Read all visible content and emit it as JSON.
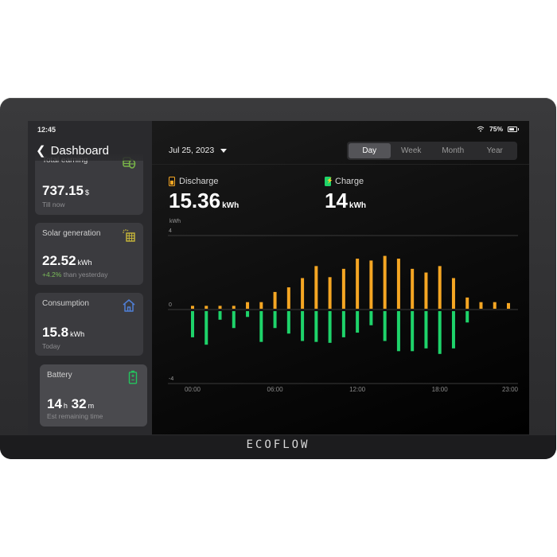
{
  "device": {
    "brand": "ECOFLOW"
  },
  "status_bar": {
    "time": "12:45",
    "battery_percent": "75%",
    "wifi_icon": "wifi-icon",
    "battery_icon": "battery-icon"
  },
  "sidebar": {
    "back_label": "Dashboard",
    "cards": [
      {
        "title": "Total earning",
        "value": "737.15",
        "unit": "$",
        "sub": "Till now",
        "icon": "coins-stack-icon",
        "icon_color": "#7ab648"
      },
      {
        "title": "Solar generation",
        "value": "22.52",
        "unit": "kWh",
        "sub_highlight": "+4.2%",
        "sub": " than yesterday",
        "icon": "solar-panel-icon",
        "icon_color": "#c9b83a"
      },
      {
        "title": "Consumption",
        "value": "15.8",
        "unit": "kWh",
        "sub": "Today",
        "icon": "house-icon",
        "icon_color": "#4f7fd6"
      },
      {
        "title": "Battery",
        "hours": "14",
        "hours_unit": "h",
        "minutes": "32",
        "minutes_unit": "m",
        "sub": "Est remaining time",
        "icon": "battery-icon",
        "icon_color": "#23c55e",
        "active": true
      }
    ]
  },
  "main": {
    "date": "Jul 25, 2023",
    "tabs": [
      {
        "label": "Day",
        "active": true
      },
      {
        "label": "Week",
        "active": false
      },
      {
        "label": "Month",
        "active": false
      },
      {
        "label": "Year",
        "active": false
      }
    ],
    "discharge": {
      "label": "Discharge",
      "value": "15.36",
      "unit": "kWh",
      "color": "#F5A623"
    },
    "charge": {
      "label": "Charge",
      "value": "14",
      "unit": "kWh",
      "color": "#1ED36A"
    }
  },
  "chart_data": {
    "type": "bar",
    "title": "",
    "ylabel": "kWh",
    "xlabel": "",
    "ylim": [
      -4,
      4
    ],
    "y_ticks": [
      "4",
      "0",
      "-4"
    ],
    "y_tick_values": [
      4,
      0,
      -4
    ],
    "x_tick_labels": [
      "00:00",
      "06:00",
      "12:00",
      "18:00",
      "23:00"
    ],
    "x_tick_indices": [
      0,
      6,
      12,
      18,
      23
    ],
    "categories": [
      "00:00",
      "01:00",
      "02:00",
      "03:00",
      "04:00",
      "05:00",
      "06:00",
      "07:00",
      "08:00",
      "09:00",
      "10:00",
      "11:00",
      "12:00",
      "13:00",
      "14:00",
      "15:00",
      "16:00",
      "17:00",
      "18:00",
      "19:00",
      "20:00",
      "21:00",
      "22:00",
      "23:00"
    ],
    "series": [
      {
        "name": "Discharge",
        "color": "#F5A623",
        "values": [
          0.2,
          0.2,
          0.2,
          0.2,
          0.4,
          0.4,
          0.95,
          1.2,
          1.7,
          2.35,
          1.75,
          2.2,
          2.75,
          2.65,
          2.9,
          2.75,
          2.2,
          2.0,
          2.35,
          1.7,
          0.65,
          0.4,
          0.4,
          0.35
        ]
      },
      {
        "name": "Charge",
        "color": "#1ED36A",
        "values": [
          -1.5,
          -1.9,
          -0.55,
          -1.0,
          -0.4,
          -1.75,
          -1.0,
          -1.3,
          -1.7,
          -1.75,
          -1.8,
          -1.5,
          -1.25,
          -0.85,
          -1.7,
          -2.25,
          -2.25,
          -2.1,
          -2.4,
          -2.1,
          -0.7,
          0,
          0,
          0
        ]
      }
    ],
    "grid": true,
    "legend": "none"
  }
}
